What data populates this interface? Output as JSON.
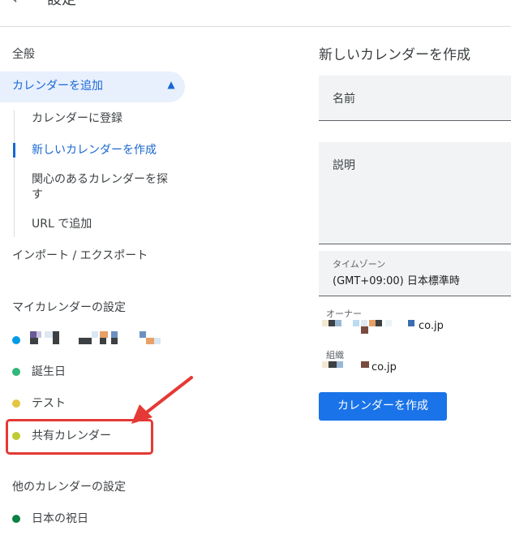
{
  "header": {
    "back_icon": "arrow-left-icon",
    "title": "設定"
  },
  "sidebar": {
    "general": "全般",
    "add_calendar": "カレンダーを追加",
    "add_sub": [
      "カレンダーに登録",
      "新しいカレンダーを作成",
      "関心のあるカレンダーを探",
      "す",
      "URL で追加"
    ],
    "import_export": "インポート / エクスポート",
    "my_calendars_heading": "マイカレンダーの設定",
    "my_calendars": [
      {
        "name": "",
        "color": "#039be5"
      },
      {
        "name": "誕生日",
        "color": "#33b679"
      },
      {
        "name": "テスト",
        "color": "#e4c441"
      },
      {
        "name": "共有カレンダー",
        "color": "#c0ca33"
      }
    ],
    "other_calendars_heading": "他のカレンダーの設定",
    "other_calendars": [
      {
        "name": "日本の祝日",
        "color": "#0b8043"
      }
    ]
  },
  "form": {
    "heading": "新しいカレンダーを作成",
    "name_label": "名前",
    "description_label": "説明",
    "timezone_label": "タイムゾーン",
    "timezone_value": "(GMT+09:00) 日本標準時",
    "owner_label": "オーナー",
    "owner_domain": "co.jp",
    "org_label": "組織",
    "org_domain": "co.jp",
    "create_button": "カレンダーを作成"
  },
  "colors": {
    "accent": "#1a73e8",
    "highlight_box": "#e53935"
  }
}
